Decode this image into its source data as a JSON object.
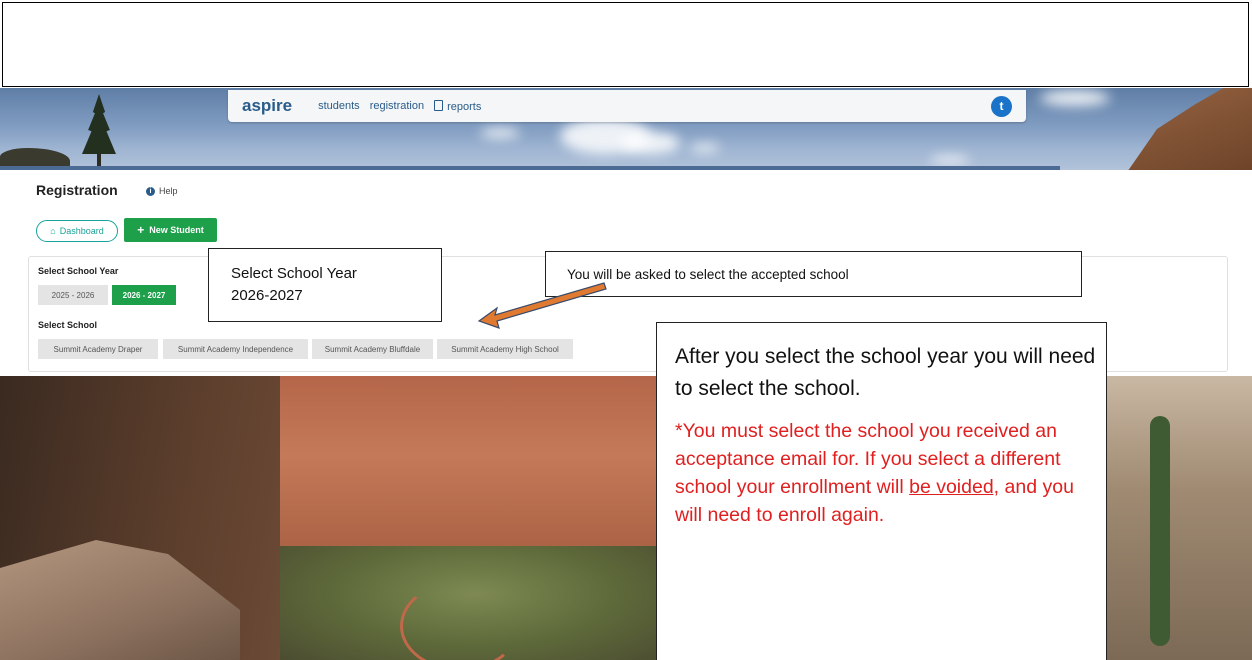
{
  "nav": {
    "brand": "aspire",
    "links": [
      "students",
      "registration",
      "reports"
    ],
    "avatar_initial": "t"
  },
  "page": {
    "title": "Registration",
    "help": "Help"
  },
  "buttons": {
    "dashboard": "Dashboard",
    "new_student": "New Student"
  },
  "school_year": {
    "label": "Select School Year",
    "options": [
      "2025 - 2026",
      "2026 - 2027"
    ],
    "selected": "2026 - 2027"
  },
  "school": {
    "label": "Select School",
    "options": [
      "Summit Academy Draper",
      "Summit Academy Independence",
      "Summit Academy Bluffdale",
      "Summit Academy High School"
    ]
  },
  "annotations": {
    "year_note_line1": "Select School Year",
    "year_note_line2": "2026-2027",
    "school_note": "You will be asked to select the accepted school",
    "instruction": "After you select the school year you will need to select the school.",
    "warning_before": "*You must select the school you received an acceptance email for. If you select a different school your enrollment will ",
    "warning_underlined": "be voided,",
    "warning_after": " and you will need to enroll again."
  },
  "colors": {
    "brand_blue": "#2a5c8a",
    "green": "#1ea04a",
    "teal": "#1aa39a",
    "warning_red": "#e02020",
    "arrow_orange": "#e07a30"
  }
}
